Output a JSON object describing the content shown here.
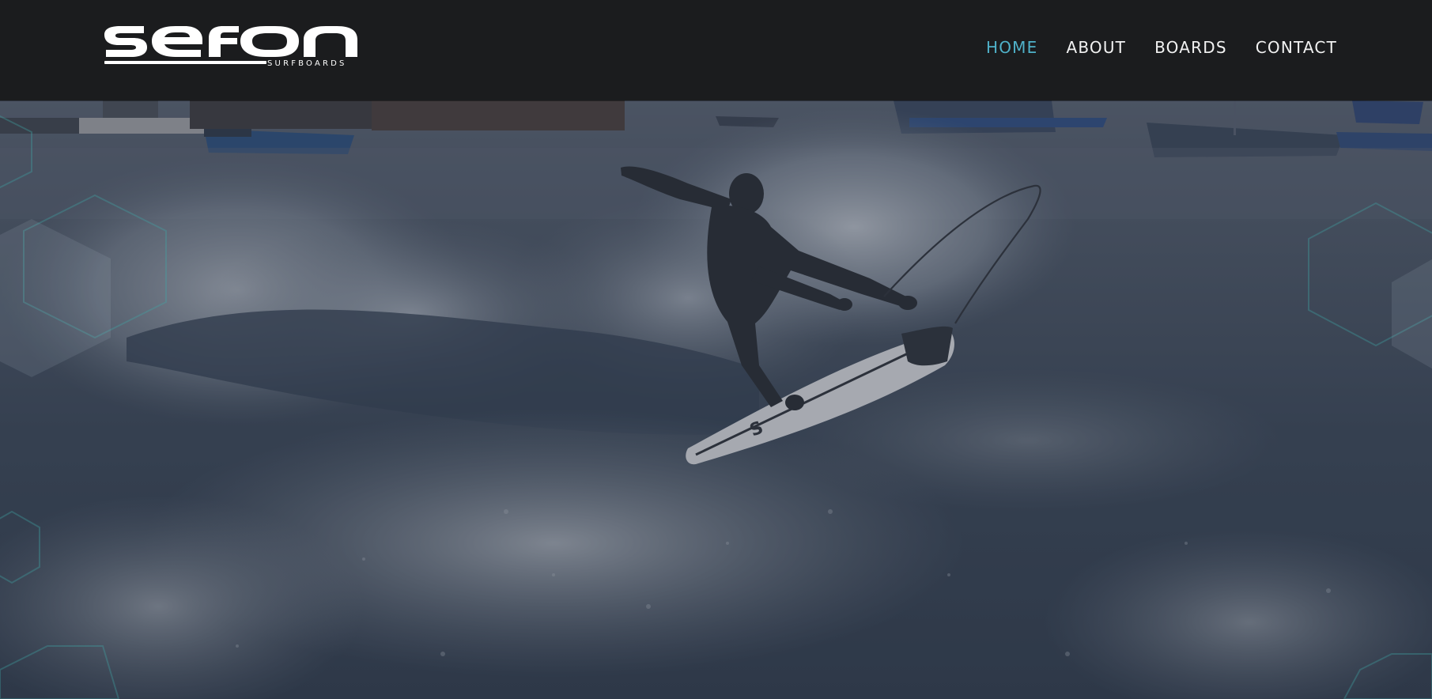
{
  "brand": {
    "name": "sefon",
    "tagline": "SURFBOARDS"
  },
  "nav": {
    "items": [
      {
        "label": "HOME",
        "active": true
      },
      {
        "label": "ABOUT",
        "active": false
      },
      {
        "label": "BOARDS",
        "active": false
      },
      {
        "label": "CONTACT",
        "active": false
      }
    ]
  },
  "hero": {
    "image_alt": "Surfer carving a wave with a white surfboard, fishing boats in the harbor behind"
  },
  "colors": {
    "header_bg": "#1b1c1e",
    "nav_active": "#4fb1c9",
    "nav_text": "#f2f2f2",
    "hero_overlay": "#2e3646",
    "hex_outline": "#3fa5a5"
  }
}
